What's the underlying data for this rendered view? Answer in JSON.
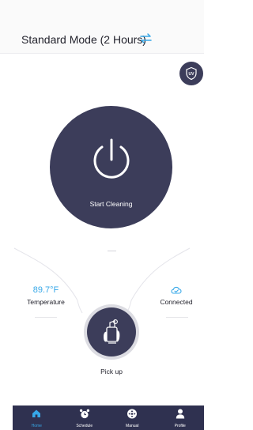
{
  "header": {
    "mode_title": "Standard Mode (2 Hours)",
    "swap_icon": "swap-arrows-icon"
  },
  "uv": {
    "badge_text": "UV",
    "icon": "uv-shield-icon"
  },
  "power": {
    "label": "Start Cleaning",
    "icon": "power-icon"
  },
  "status": {
    "temperature_value": "89.7°F",
    "temperature_label": "Temperature",
    "connection_icon": "cloud-check-icon",
    "connection_label": "Connected"
  },
  "pickup": {
    "label": "Pick up",
    "icon": "hand-pickup-icon"
  },
  "tabs": [
    {
      "label": "Home",
      "icon": "home-icon",
      "active": true
    },
    {
      "label": "Schedule",
      "icon": "alarm-clock-icon",
      "active": false
    },
    {
      "label": "Manual",
      "icon": "dpad-icon",
      "active": false
    },
    {
      "label": "Profile",
      "icon": "person-icon",
      "active": false
    }
  ],
  "colors": {
    "primary_dark": "#3c3d5a",
    "accent": "#37a8e8",
    "tabbar": "#2f3150"
  }
}
